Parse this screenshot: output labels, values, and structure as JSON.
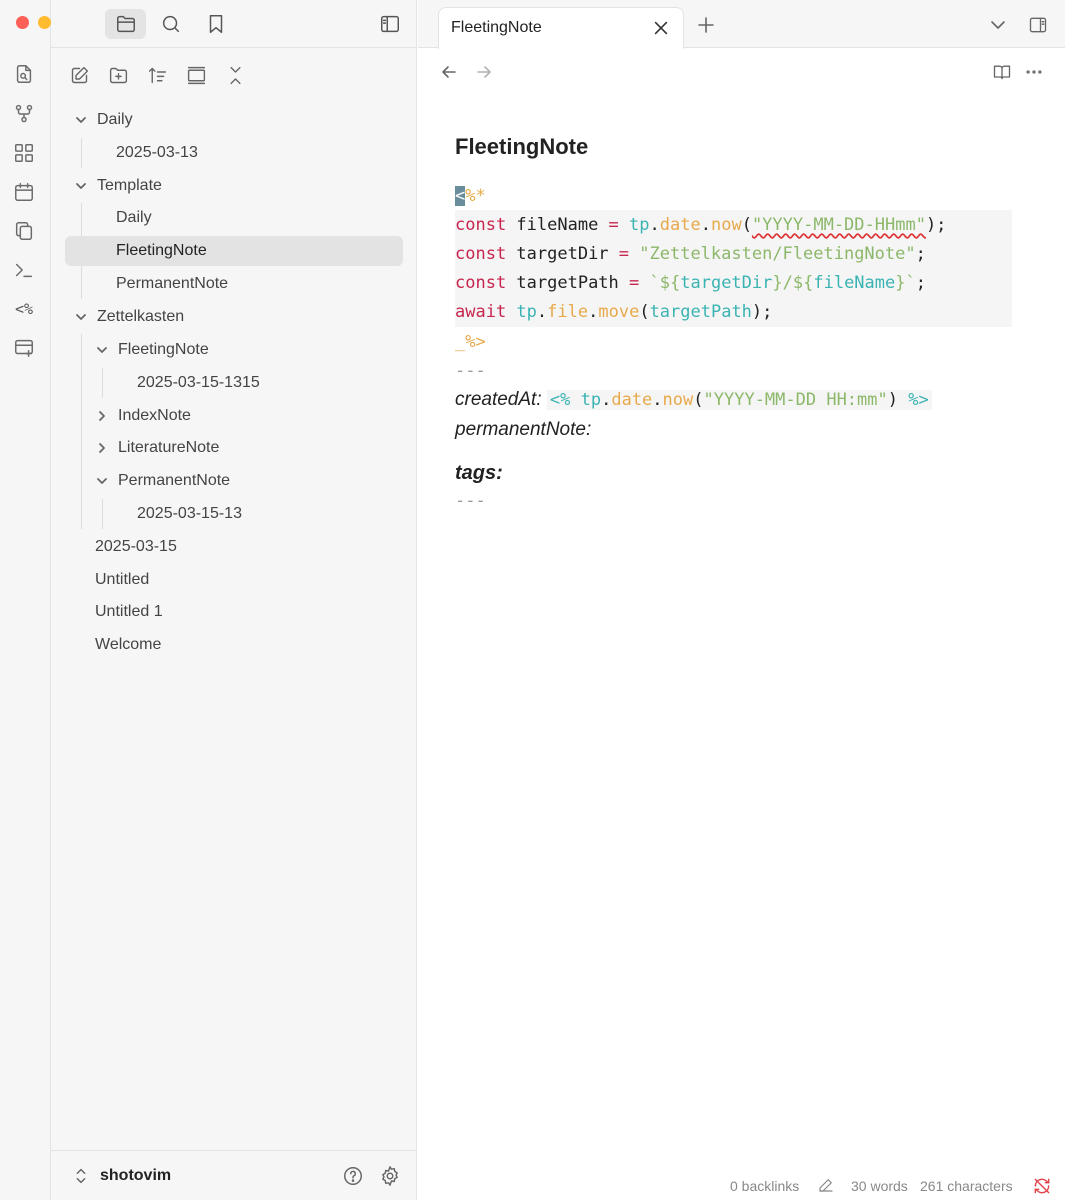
{
  "sidebar": {
    "tree": [
      {
        "label": "Daily",
        "type": "folder",
        "expanded": true
      },
      {
        "label": "2025-03-13",
        "type": "file"
      },
      {
        "label": "Template",
        "type": "folder",
        "expanded": true
      },
      {
        "label": "Daily",
        "type": "file"
      },
      {
        "label": "FleetingNote",
        "type": "file",
        "active": true
      },
      {
        "label": "PermanentNote",
        "type": "file"
      },
      {
        "label": "Zettelkasten",
        "type": "folder",
        "expanded": true
      },
      {
        "label": "FleetingNote",
        "type": "folder",
        "expanded": true
      },
      {
        "label": "2025-03-15-1315",
        "type": "file"
      },
      {
        "label": "IndexNote",
        "type": "folder",
        "expanded": false
      },
      {
        "label": "LiteratureNote",
        "type": "folder",
        "expanded": false
      },
      {
        "label": "PermanentNote",
        "type": "folder",
        "expanded": true
      },
      {
        "label": "2025-03-15-13",
        "type": "file"
      },
      {
        "label": "2025-03-15",
        "type": "file"
      },
      {
        "label": "Untitled",
        "type": "file"
      },
      {
        "label": "Untitled 1",
        "type": "file"
      },
      {
        "label": "Welcome",
        "type": "file"
      }
    ],
    "vault_name": "shotovim"
  },
  "tab": {
    "title": "FleetingNote"
  },
  "note": {
    "title": "FleetingNote",
    "code": {
      "open_tag_cursor": "<",
      "open_tag_rest": "%*",
      "line1": {
        "kw": "const",
        "name": " fileName ",
        "op": "=",
        "tp": " tp",
        "dot1": ".",
        "obj": "date",
        "dot2": ".",
        "fn": "now",
        "paren_open": "(",
        "str": "\"YYYY-MM-DD-HHmm\"",
        "end": ");"
      },
      "line2": {
        "kw": "const",
        "name": " targetDir ",
        "op": "=",
        "str": " \"Zettelkasten/FleetingNote\"",
        "end": ";"
      },
      "line3": {
        "kw": "const",
        "name": " targetPath ",
        "op": "=",
        "sp": " ",
        "tick1": "`",
        "tpl_open1": "${",
        "var1": "targetDir",
        "tpl_close1": "}",
        "slash": "/",
        "tpl_open2": "${",
        "var2": "fileName",
        "tpl_close2": "}",
        "tick2": "`",
        "end": ";"
      },
      "line4": {
        "kw": "await",
        "tp": " tp",
        "dot1": ".",
        "obj": "file",
        "dot2": ".",
        "fn": "move",
        "paren_open": "(",
        "arg": "targetPath",
        "end": ");"
      },
      "close_tag": "_%>"
    },
    "frontmatter_open": "---",
    "created_key": "createdAt:",
    "created_code": {
      "open": "<%",
      "tp": " tp",
      "dot1": ".",
      "obj": "date",
      "dot2": ".",
      "fn": "now",
      "paren_open": "(",
      "str": "\"YYYY-MM-DD HH:mm\"",
      "paren_close": ")",
      "close": " %>"
    },
    "permanent_key": "permanentNote:",
    "tags_key": "tags:",
    "frontmatter_close": "---"
  },
  "status": {
    "backlinks": "0 backlinks",
    "words": "30 words",
    "characters": "261 characters"
  },
  "ribbon": {
    "templater_label": "<%",
    "terminal_label": ">_"
  }
}
